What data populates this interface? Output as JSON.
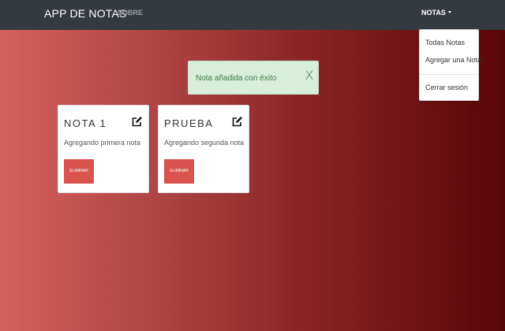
{
  "navbar": {
    "brand": "APP DE NOTAS",
    "about_label": "SOBRE",
    "dropdown_label": "NOTAS"
  },
  "dropdown": {
    "items": [
      {
        "label": "Todas Notas"
      },
      {
        "label": "Agregar una Nota"
      },
      {
        "label": "Cerrar sesión"
      }
    ]
  },
  "alert": {
    "message": "Nota añadida con éxito",
    "close_label": "X"
  },
  "notes": [
    {
      "title": "NOTA 1",
      "body": "Agregando primera nota",
      "delete_label": "ELIMINAR",
      "icon": "edit-icon"
    },
    {
      "title": "PRUEBA",
      "body": "Agregando segunda nota",
      "delete_label": "ELIMINAR",
      "icon": "edit-icon"
    }
  ],
  "colors": {
    "navbar_bg": "#343a40",
    "alert_bg": "#d7eed9",
    "alert_text": "#3d7a46",
    "danger": "#d9534f",
    "gradient_start": "#d6605e",
    "gradient_end": "#5a0608"
  }
}
